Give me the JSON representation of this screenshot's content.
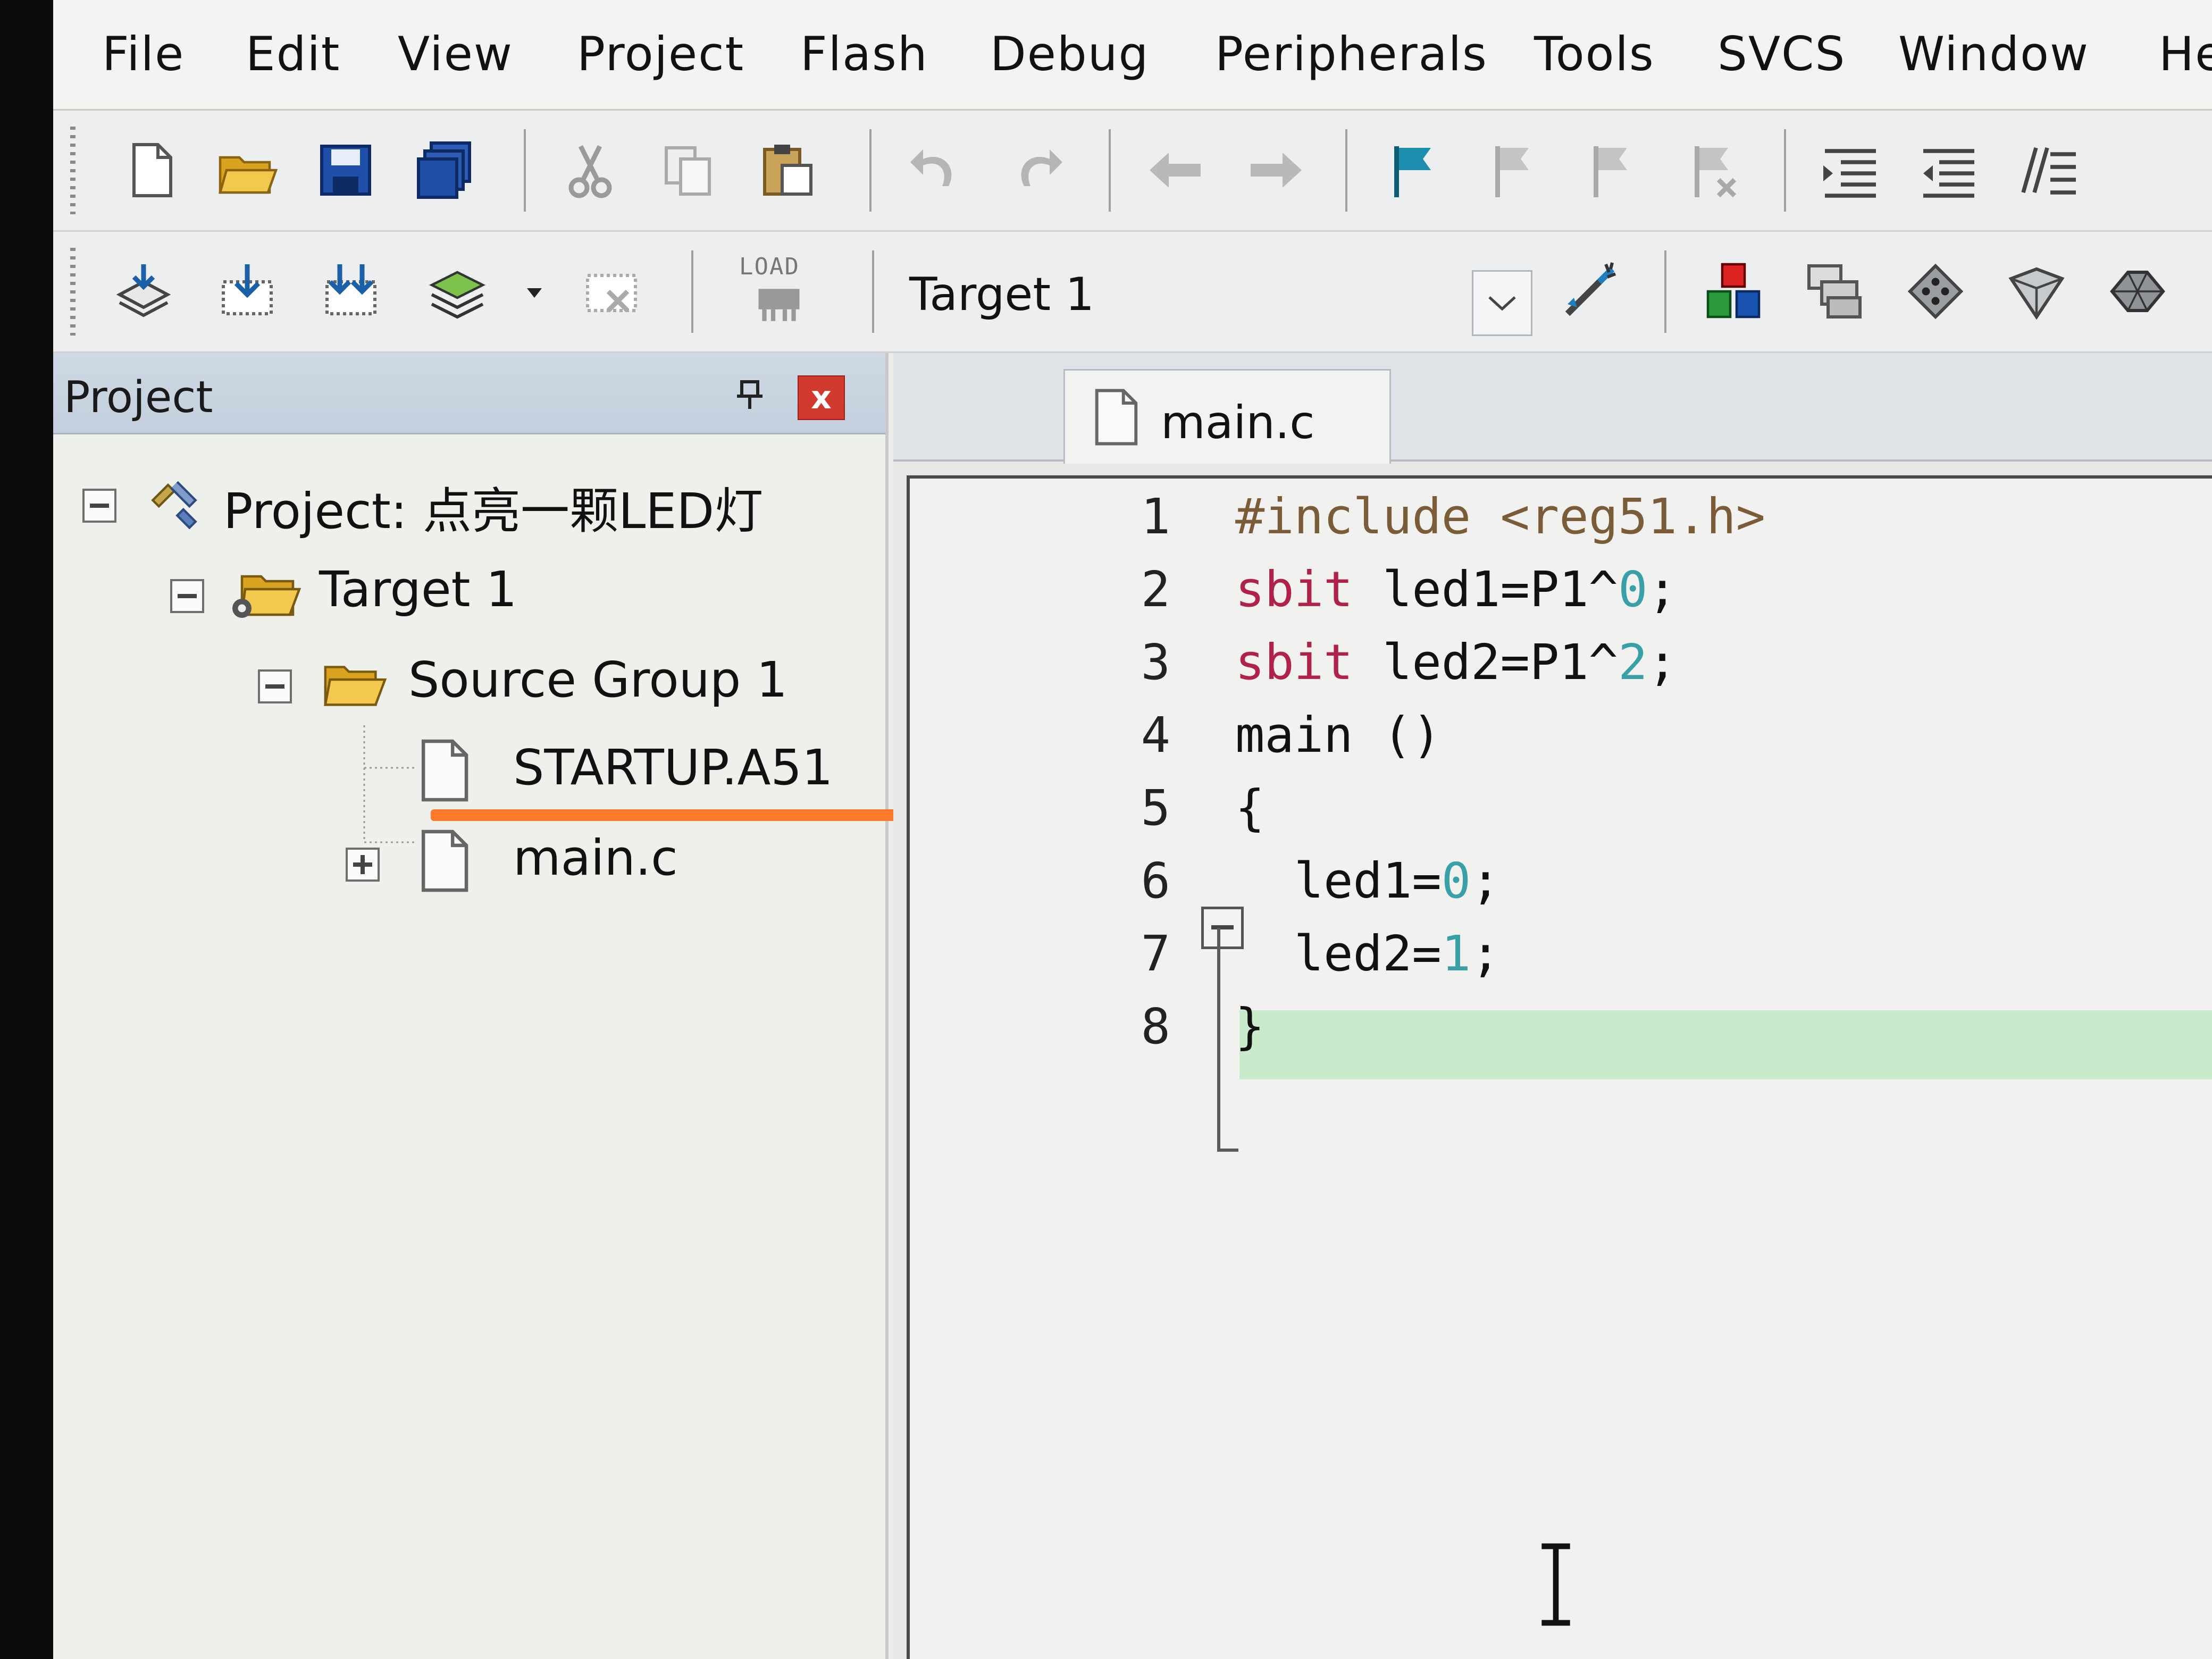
{
  "menu": {
    "items": [
      "File",
      "Edit",
      "View",
      "Project",
      "Flash",
      "Debug",
      "Peripherals",
      "Tools",
      "SVCS",
      "Window",
      "He"
    ]
  },
  "toolbar2": {
    "load_label": "LOAD",
    "target_select": "Target 1"
  },
  "project_panel": {
    "title": "Project",
    "close_label": "x",
    "tree": {
      "project": "Project: 点亮一颗LED灯",
      "target": "Target 1",
      "group": "Source Group 1",
      "file_startup": "STARTUP.A51",
      "file_main": "main.c"
    }
  },
  "editor": {
    "tab_label": "main.c",
    "line_numbers": [
      "1",
      "2",
      "3",
      "4",
      "5",
      "6",
      "7",
      "8"
    ],
    "code": {
      "l1_directive": "#include",
      "l1_header": " <reg51.h>",
      "l2_kw": "sbit",
      "l2_body": " led1=P1^",
      "l2_num": "0",
      "l2_end": ";",
      "l3_kw": "sbit",
      "l3_body": " led2=P1^",
      "l3_num": "2",
      "l3_end": ";",
      "l4": "main ()",
      "l5": "{",
      "l6_body": "  led1=",
      "l6_num": "0",
      "l6_end": ";",
      "l7_body": "  led2=",
      "l7_num": "1",
      "l7_end": ";",
      "l8": "}"
    }
  },
  "colors": {
    "keyword": "#b0224a",
    "number": "#3aa0a8",
    "highlight_line": "#c9ebcc",
    "annotation_underline": "#ff7a2a",
    "close_button": "#d23a2f"
  }
}
